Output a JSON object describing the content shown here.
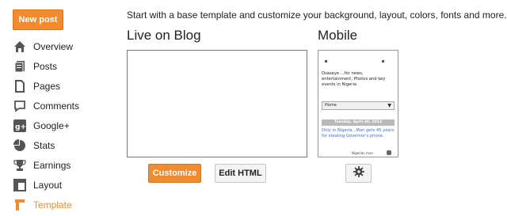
{
  "sidebar": {
    "new_post": "New post",
    "items": [
      {
        "label": "Overview",
        "icon": "home-icon"
      },
      {
        "label": "Posts",
        "icon": "posts-icon"
      },
      {
        "label": "Pages",
        "icon": "pages-icon"
      },
      {
        "label": "Comments",
        "icon": "comments-icon"
      },
      {
        "label": "Google+",
        "icon": "google-plus-icon"
      },
      {
        "label": "Stats",
        "icon": "stats-icon"
      },
      {
        "label": "Earnings",
        "icon": "trophy-icon"
      },
      {
        "label": "Layout",
        "icon": "layout-icon"
      },
      {
        "label": "Template",
        "icon": "template-icon",
        "active": true
      }
    ]
  },
  "main": {
    "intro": "Start with a base template and customize your background, layout, colors, fonts and more...",
    "live_heading": "Live on Blog",
    "mobile_heading": "Mobile",
    "customize_label": "Customize",
    "edit_html_label": "Edit HTML"
  },
  "mobile_preview": {
    "description": "Osaseye ...for news, entertainment, Photos and key events in Nigeria",
    "select_value": "Home",
    "date": "Tuesday, April 30, 2013",
    "post_title": "Only in Nigeria...Man gets 45 years for stealing Governor's phone.",
    "footer_text": "Nigerian man"
  },
  "colors": {
    "accent": "#f08b2f",
    "link": "#3a6fd1"
  }
}
